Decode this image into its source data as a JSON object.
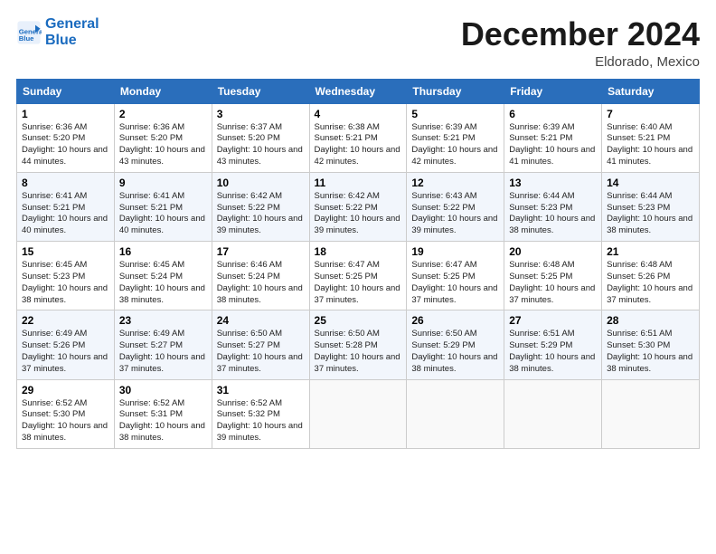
{
  "header": {
    "logo_line1": "General",
    "logo_line2": "Blue",
    "month": "December 2024",
    "location": "Eldorado, Mexico"
  },
  "days_of_week": [
    "Sunday",
    "Monday",
    "Tuesday",
    "Wednesday",
    "Thursday",
    "Friday",
    "Saturday"
  ],
  "weeks": [
    [
      {
        "day": "1",
        "sunrise": "6:36 AM",
        "sunset": "5:20 PM",
        "daylight": "10 hours and 44 minutes."
      },
      {
        "day": "2",
        "sunrise": "6:36 AM",
        "sunset": "5:20 PM",
        "daylight": "10 hours and 43 minutes."
      },
      {
        "day": "3",
        "sunrise": "6:37 AM",
        "sunset": "5:20 PM",
        "daylight": "10 hours and 43 minutes."
      },
      {
        "day": "4",
        "sunrise": "6:38 AM",
        "sunset": "5:21 PM",
        "daylight": "10 hours and 42 minutes."
      },
      {
        "day": "5",
        "sunrise": "6:39 AM",
        "sunset": "5:21 PM",
        "daylight": "10 hours and 42 minutes."
      },
      {
        "day": "6",
        "sunrise": "6:39 AM",
        "sunset": "5:21 PM",
        "daylight": "10 hours and 41 minutes."
      },
      {
        "day": "7",
        "sunrise": "6:40 AM",
        "sunset": "5:21 PM",
        "daylight": "10 hours and 41 minutes."
      }
    ],
    [
      {
        "day": "8",
        "sunrise": "6:41 AM",
        "sunset": "5:21 PM",
        "daylight": "10 hours and 40 minutes."
      },
      {
        "day": "9",
        "sunrise": "6:41 AM",
        "sunset": "5:21 PM",
        "daylight": "10 hours and 40 minutes."
      },
      {
        "day": "10",
        "sunrise": "6:42 AM",
        "sunset": "5:22 PM",
        "daylight": "10 hours and 39 minutes."
      },
      {
        "day": "11",
        "sunrise": "6:42 AM",
        "sunset": "5:22 PM",
        "daylight": "10 hours and 39 minutes."
      },
      {
        "day": "12",
        "sunrise": "6:43 AM",
        "sunset": "5:22 PM",
        "daylight": "10 hours and 39 minutes."
      },
      {
        "day": "13",
        "sunrise": "6:44 AM",
        "sunset": "5:23 PM",
        "daylight": "10 hours and 38 minutes."
      },
      {
        "day": "14",
        "sunrise": "6:44 AM",
        "sunset": "5:23 PM",
        "daylight": "10 hours and 38 minutes."
      }
    ],
    [
      {
        "day": "15",
        "sunrise": "6:45 AM",
        "sunset": "5:23 PM",
        "daylight": "10 hours and 38 minutes."
      },
      {
        "day": "16",
        "sunrise": "6:45 AM",
        "sunset": "5:24 PM",
        "daylight": "10 hours and 38 minutes."
      },
      {
        "day": "17",
        "sunrise": "6:46 AM",
        "sunset": "5:24 PM",
        "daylight": "10 hours and 38 minutes."
      },
      {
        "day": "18",
        "sunrise": "6:47 AM",
        "sunset": "5:25 PM",
        "daylight": "10 hours and 37 minutes."
      },
      {
        "day": "19",
        "sunrise": "6:47 AM",
        "sunset": "5:25 PM",
        "daylight": "10 hours and 37 minutes."
      },
      {
        "day": "20",
        "sunrise": "6:48 AM",
        "sunset": "5:25 PM",
        "daylight": "10 hours and 37 minutes."
      },
      {
        "day": "21",
        "sunrise": "6:48 AM",
        "sunset": "5:26 PM",
        "daylight": "10 hours and 37 minutes."
      }
    ],
    [
      {
        "day": "22",
        "sunrise": "6:49 AM",
        "sunset": "5:26 PM",
        "daylight": "10 hours and 37 minutes."
      },
      {
        "day": "23",
        "sunrise": "6:49 AM",
        "sunset": "5:27 PM",
        "daylight": "10 hours and 37 minutes."
      },
      {
        "day": "24",
        "sunrise": "6:50 AM",
        "sunset": "5:27 PM",
        "daylight": "10 hours and 37 minutes."
      },
      {
        "day": "25",
        "sunrise": "6:50 AM",
        "sunset": "5:28 PM",
        "daylight": "10 hours and 37 minutes."
      },
      {
        "day": "26",
        "sunrise": "6:50 AM",
        "sunset": "5:29 PM",
        "daylight": "10 hours and 38 minutes."
      },
      {
        "day": "27",
        "sunrise": "6:51 AM",
        "sunset": "5:29 PM",
        "daylight": "10 hours and 38 minutes."
      },
      {
        "day": "28",
        "sunrise": "6:51 AM",
        "sunset": "5:30 PM",
        "daylight": "10 hours and 38 minutes."
      }
    ],
    [
      {
        "day": "29",
        "sunrise": "6:52 AM",
        "sunset": "5:30 PM",
        "daylight": "10 hours and 38 minutes."
      },
      {
        "day": "30",
        "sunrise": "6:52 AM",
        "sunset": "5:31 PM",
        "daylight": "10 hours and 38 minutes."
      },
      {
        "day": "31",
        "sunrise": "6:52 AM",
        "sunset": "5:32 PM",
        "daylight": "10 hours and 39 minutes."
      },
      null,
      null,
      null,
      null
    ]
  ]
}
